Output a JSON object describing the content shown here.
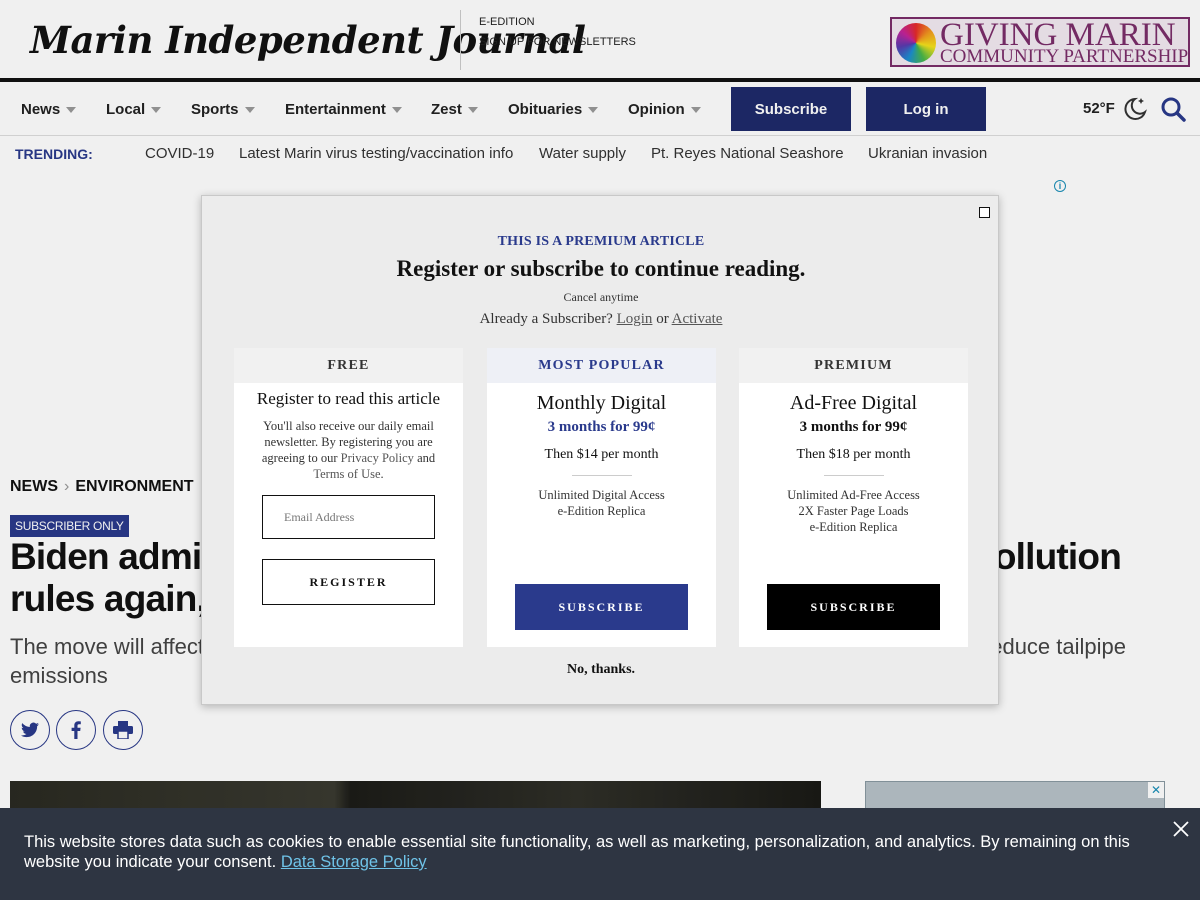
{
  "header": {
    "logo_text": "Marin Independent Journal",
    "links": [
      "E-EDITION",
      "SIGN UP FOR NEWSLETTERS"
    ],
    "ad_title": "GIVING MARIN",
    "ad_subtitle": "COMMUNITY PARTNERSHIP"
  },
  "nav": {
    "items": [
      "News",
      "Local",
      "Sports",
      "Entertainment",
      "Zest",
      "Obituaries",
      "Opinion"
    ],
    "subscribe_label": "Subscribe",
    "login_label": "Log in",
    "weather": "52°F",
    "accent_color": "#1e2a6b"
  },
  "trending": {
    "label": "TRENDING:",
    "links": [
      "COVID-19",
      "Latest Marin virus testing/vaccination info",
      "Water supply",
      "Pt. Reyes National Seashore",
      "Ukranian invasion"
    ]
  },
  "article": {
    "breadcrumb": [
      "NEWS",
      "ENVIRONMENT"
    ],
    "badge": "SUBSCRIBER ONLY",
    "headline_left_1": "Biden admir",
    "headline_right_1": "ollution",
    "headline_left_2": "rules again,",
    "dek_left_1": "The move will affect",
    "dek_right_1": "educe tailpipe",
    "dek_line_2": "emissions"
  },
  "modal": {
    "kicker": "THIS IS A PREMIUM ARTICLE",
    "title": "Register or subscribe to continue reading.",
    "cancel": "Cancel anytime",
    "already_prefix": "Already a Subscriber?",
    "login_link": "Login",
    "or": "or",
    "activate_link": "Activate",
    "free": {
      "head": "FREE",
      "title": "Register to read this article",
      "body_1": "You'll also receive our daily email newsletter. By registering you are agreeing to our ",
      "privacy_link": "Privacy Policy",
      "body_2": " and ",
      "terms_link": "Terms of Use",
      "body_3": ".",
      "email_placeholder": "Email Address",
      "register_label": "REGISTER"
    },
    "monthly": {
      "head": "MOST POPULAR",
      "name": "Monthly Digital",
      "offer": "3 months for 99¢",
      "then": "Then $14 per month",
      "features": [
        "Unlimited Digital Access",
        "e-Edition Replica"
      ],
      "subscribe_label": "SUBSCRIBE",
      "button_color": "#2a3a8c"
    },
    "premium": {
      "head": "PREMIUM",
      "name": "Ad-Free Digital",
      "offer": "3 months for 99¢",
      "then": "Then $18 per month",
      "features": [
        "Unlimited Ad-Free Access",
        "2X Faster Page Loads",
        "e-Edition Replica"
      ],
      "subscribe_label": "SUBSCRIBE",
      "button_color": "#000000"
    },
    "no_thanks": "No, thanks."
  },
  "cookie": {
    "text": "This website stores data such as cookies to enable essential site functionality, as well as marketing, personalization, and analytics. By remaining on this website you indicate your consent.",
    "link": "Data Storage Policy"
  }
}
